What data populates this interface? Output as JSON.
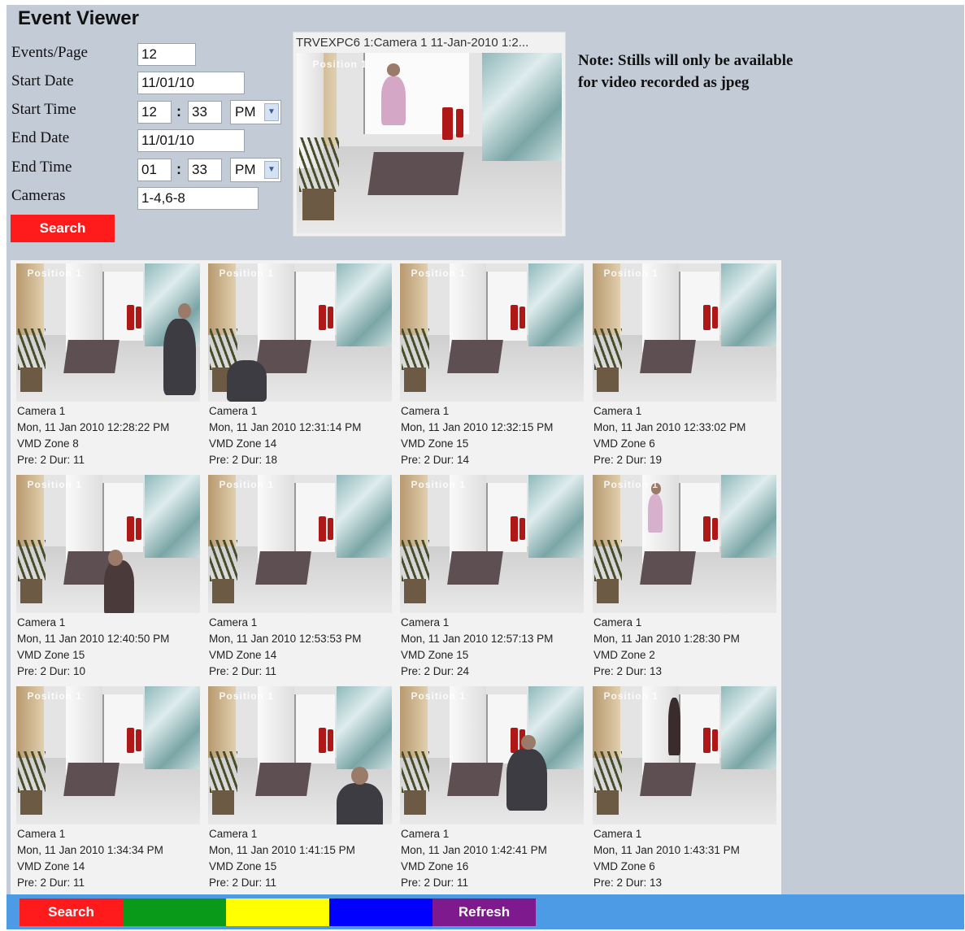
{
  "app": {
    "title": "Event Viewer",
    "note": "Note: Stills will only be available for video recorded as jpeg"
  },
  "form": {
    "events_page": {
      "label": "Events/Page",
      "value": "12"
    },
    "start_date": {
      "label": "Start Date",
      "value": "11/01/10"
    },
    "start_time": {
      "label": "Start Time",
      "hour": "12",
      "minute": "33",
      "ampm": "PM"
    },
    "end_date": {
      "label": "End Date",
      "value": "11/01/10"
    },
    "end_time": {
      "label": "End Time",
      "hour": "01",
      "minute": "33",
      "ampm": "PM"
    },
    "cameras": {
      "label": "Cameras",
      "value": "1-4,6-8"
    },
    "separator": ":",
    "search_label": "Search"
  },
  "preview": {
    "caption": "TRVEXPC6 1:Camera 1 11-Jan-2010 1:2...",
    "osd": "Position 1"
  },
  "events": [
    {
      "camera": "Camera 1",
      "datetime": "Mon, 11 Jan 2010 12:28:22 PM",
      "zone": "VMD Zone 8",
      "predur": "Pre: 2 Dur: 11",
      "osd": "Position 1"
    },
    {
      "camera": "Camera 1",
      "datetime": "Mon, 11 Jan 2010 12:31:14 PM",
      "zone": "VMD Zone 14",
      "predur": "Pre: 2 Dur: 18",
      "osd": "Position 1"
    },
    {
      "camera": "Camera 1",
      "datetime": "Mon, 11 Jan 2010 12:32:15 PM",
      "zone": "VMD Zone 15",
      "predur": "Pre: 2 Dur: 14",
      "osd": "Position 1"
    },
    {
      "camera": "Camera 1",
      "datetime": "Mon, 11 Jan 2010 12:33:02 PM",
      "zone": "VMD Zone 6",
      "predur": "Pre: 2 Dur: 19",
      "osd": "Position 1"
    },
    {
      "camera": "Camera 1",
      "datetime": "Mon, 11 Jan 2010 12:40:50 PM",
      "zone": "VMD Zone 15",
      "predur": "Pre: 2 Dur: 10",
      "osd": "Position 1"
    },
    {
      "camera": "Camera 1",
      "datetime": "Mon, 11 Jan 2010 12:53:53 PM",
      "zone": "VMD Zone 14",
      "predur": "Pre: 2 Dur: 11",
      "osd": "Position 1"
    },
    {
      "camera": "Camera 1",
      "datetime": "Mon, 11 Jan 2010 12:57:13 PM",
      "zone": "VMD Zone 15",
      "predur": "Pre: 2 Dur: 24",
      "osd": "Position 1"
    },
    {
      "camera": "Camera 1",
      "datetime": "Mon, 11 Jan 2010 1:28:30 PM",
      "zone": "VMD Zone 2",
      "predur": "Pre: 2 Dur: 13",
      "osd": "Position 1"
    },
    {
      "camera": "Camera 1",
      "datetime": "Mon, 11 Jan 2010 1:34:34 PM",
      "zone": "VMD Zone 14",
      "predur": "Pre: 2 Dur: 11",
      "osd": "Position 1"
    },
    {
      "camera": "Camera 1",
      "datetime": "Mon, 11 Jan 2010 1:41:15 PM",
      "zone": "VMD Zone 15",
      "predur": "Pre: 2 Dur: 11",
      "osd": "Position 1"
    },
    {
      "camera": "Camera 1",
      "datetime": "Mon, 11 Jan 2010 1:42:41 PM",
      "zone": "VMD Zone 16",
      "predur": "Pre: 2 Dur: 11",
      "osd": "Position 1"
    },
    {
      "camera": "Camera 1",
      "datetime": "Mon, 11 Jan 2010 1:43:31 PM",
      "zone": "VMD Zone 6",
      "predur": "Pre: 2 Dur: 13",
      "osd": "Position 1"
    }
  ],
  "toolbar": {
    "buttons": [
      {
        "label": "Search",
        "color": "#ff1b1b"
      },
      {
        "label": "",
        "color": "#0a9a1a"
      },
      {
        "label": "",
        "color": "#ffff00"
      },
      {
        "label": "",
        "color": "#0000ff"
      },
      {
        "label": "Refresh",
        "color": "#7e1a8e"
      }
    ]
  },
  "colors": {
    "background": "#c3cbd7",
    "toolbar": "#4d9ae5",
    "search_button": "#ff1b1b"
  }
}
